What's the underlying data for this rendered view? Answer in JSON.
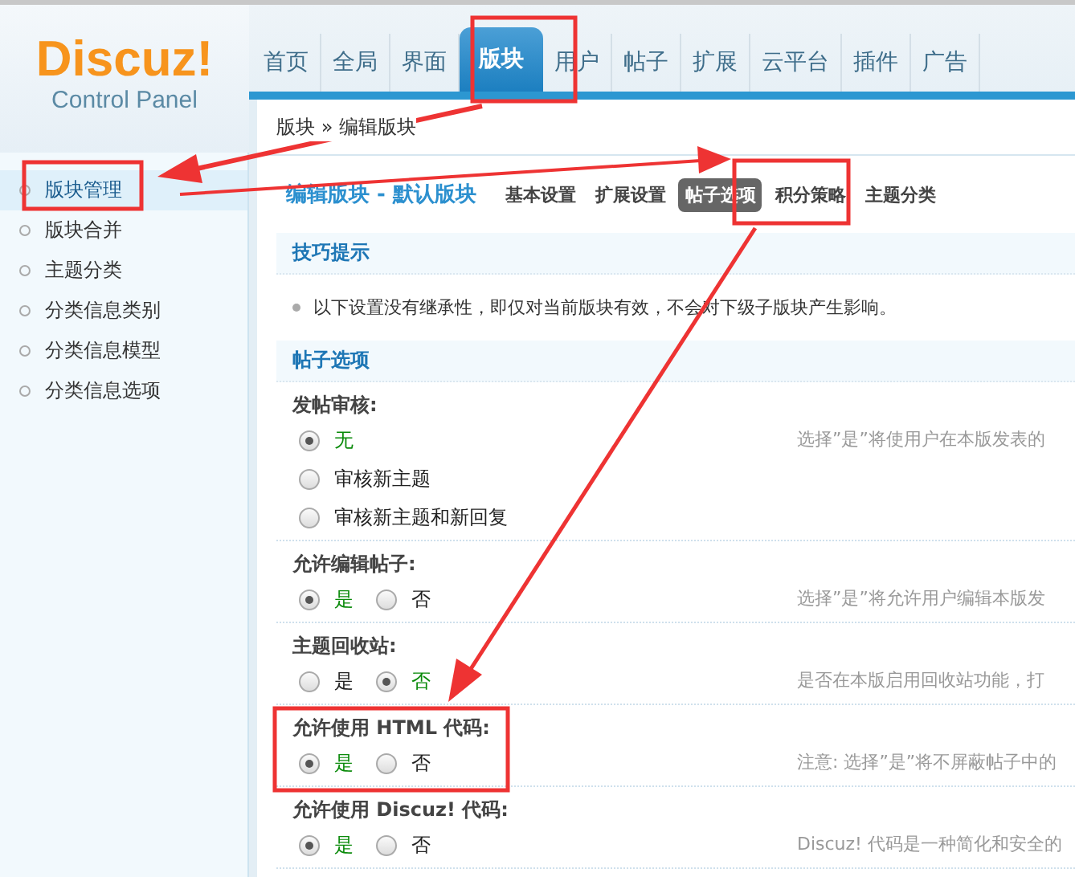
{
  "logo": {
    "brand": "Discuz!",
    "subtitle": "Control Panel"
  },
  "nav": [
    {
      "label": "首页",
      "selected": false
    },
    {
      "label": "全局",
      "selected": false
    },
    {
      "label": "界面",
      "selected": false
    },
    {
      "label": "版块",
      "selected": true
    },
    {
      "label": "用户",
      "selected": false
    },
    {
      "label": "帖子",
      "selected": false
    },
    {
      "label": "扩展",
      "selected": false
    },
    {
      "label": "云平台",
      "selected": false
    },
    {
      "label": "插件",
      "selected": false
    },
    {
      "label": "广告",
      "selected": false
    }
  ],
  "breadcrumb": "版块 » 编辑版块",
  "sidebar": {
    "items": [
      {
        "label": "版块管理",
        "selected": true
      },
      {
        "label": "版块合并",
        "selected": false
      },
      {
        "label": "主题分类",
        "selected": false
      },
      {
        "label": "分类信息类别",
        "selected": false
      },
      {
        "label": "分类信息模型",
        "selected": false
      },
      {
        "label": "分类信息选项",
        "selected": false
      }
    ]
  },
  "page_title": "编辑版块 - 默认版块",
  "subtabs": [
    {
      "label": "基本设置",
      "selected": false
    },
    {
      "label": "扩展设置",
      "selected": false
    },
    {
      "label": "帖子选项",
      "selected": true
    },
    {
      "label": "积分策略",
      "selected": false
    },
    {
      "label": "主题分类",
      "selected": false
    }
  ],
  "tips": {
    "title": "技巧提示",
    "items": [
      "以下设置没有继承性，即仅对当前版块有效，不会对下级子版块产生影响。"
    ]
  },
  "section": {
    "title": "帖子选项",
    "settings": [
      {
        "label": "发帖审核:",
        "options": [
          {
            "label": "无",
            "selected": true
          },
          {
            "label": "审核新主题",
            "selected": false
          },
          {
            "label": "审核新主题和新回复",
            "selected": false
          }
        ],
        "description": "选择”是”将使用户在本版发表的"
      },
      {
        "label": "允许编辑帖子:",
        "options": [
          {
            "label": "是",
            "selected": true
          },
          {
            "label": "否",
            "selected": false
          }
        ],
        "description": "选择”是”将允许用户编辑本版发"
      },
      {
        "label": "主题回收站:",
        "options": [
          {
            "label": "是",
            "selected": false
          },
          {
            "label": "否",
            "selected": true
          }
        ],
        "description": "是否在本版启用回收站功能，打"
      },
      {
        "label": "允许使用 HTML 代码:",
        "options": [
          {
            "label": "是",
            "selected": true
          },
          {
            "label": "否",
            "selected": false
          }
        ],
        "description": "注意: 选择”是”将不屏蔽帖子中的"
      },
      {
        "label": "允许使用 Discuz! 代码:",
        "options": [
          {
            "label": "是",
            "selected": true
          },
          {
            "label": "否",
            "selected": false
          }
        ],
        "description": "Discuz! 代码是一种简化和安全的"
      }
    ]
  }
}
